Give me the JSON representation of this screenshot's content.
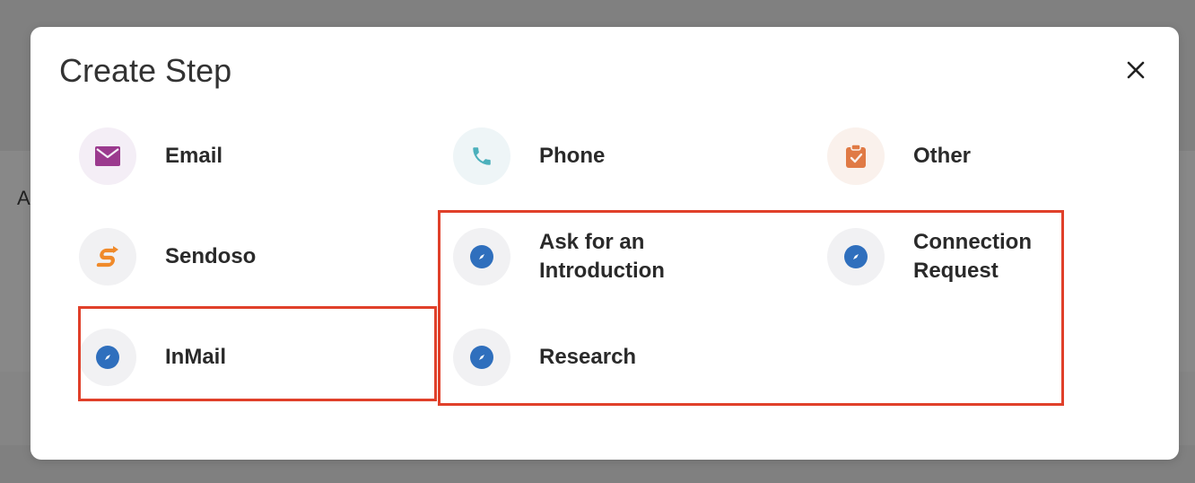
{
  "backdrop": {
    "peek_text": "A"
  },
  "modal": {
    "title": "Create Step",
    "close_label": "×"
  },
  "steps": [
    {
      "label": "Email",
      "icon": "envelope-icon",
      "color": "#9b3a8e"
    },
    {
      "label": "Phone",
      "icon": "phone-icon",
      "color": "#4bb0bc"
    },
    {
      "label": "Other",
      "icon": "clipboard-check-icon",
      "color": "#e07a45"
    },
    {
      "label": "Sendoso",
      "icon": "sendoso-logo-icon",
      "color": "#f08a2a"
    },
    {
      "label_line1": "Ask for an",
      "label_line2": "Introduction",
      "icon": "compass-icon",
      "color": "#2f6fbd"
    },
    {
      "label_line1": "Connection",
      "label_line2": "Request",
      "icon": "compass-icon",
      "color": "#2f6fbd"
    },
    {
      "label": "InMail",
      "icon": "compass-icon",
      "color": "#2f6fbd"
    },
    {
      "label": "Research",
      "icon": "compass-icon",
      "color": "#2f6fbd"
    }
  ],
  "colors": {
    "highlight": "#e0402a",
    "modal_bg": "#ffffff",
    "overlay": "#808080"
  }
}
